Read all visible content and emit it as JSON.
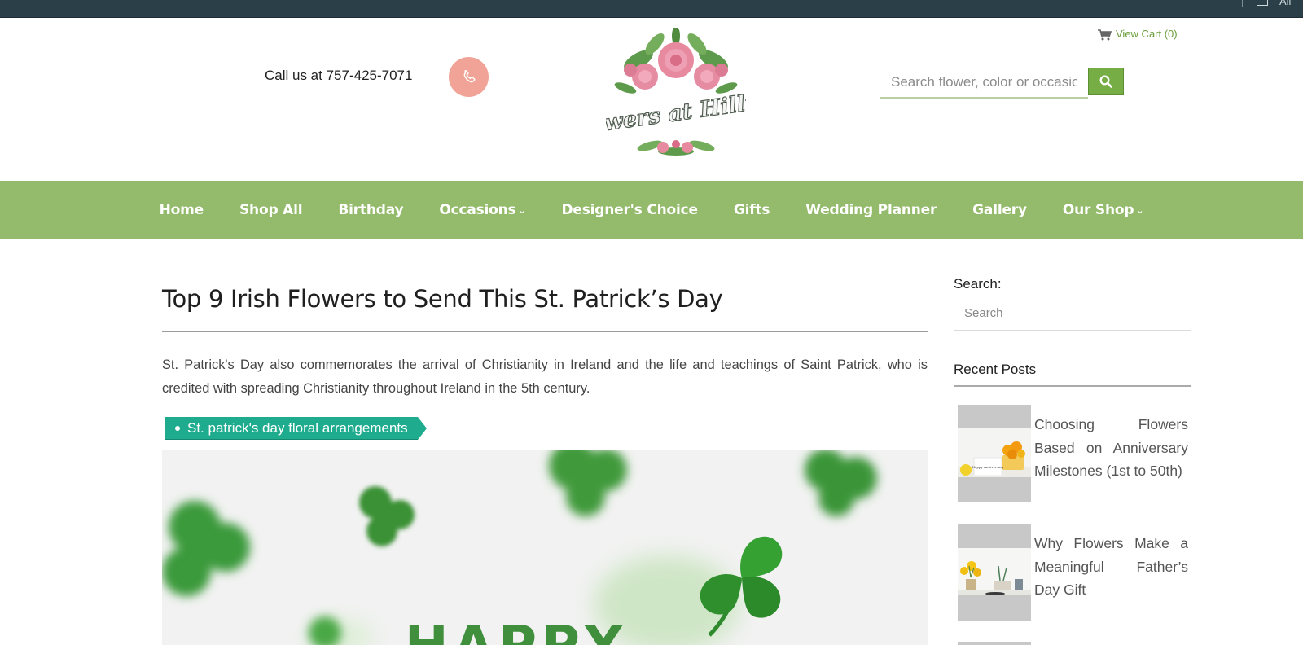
{
  "topbar": {
    "account_text": "All"
  },
  "header": {
    "call_text": "Call us at 757-425-7071",
    "logo_text": "Flowers at Hilltop",
    "cart_label": "View Cart (0)",
    "search_placeholder": "Search flower, color or occasion",
    "icons": {
      "phone": "phone-icon",
      "cart": "cart-icon",
      "search": "search-icon"
    }
  },
  "nav": {
    "items": [
      {
        "label": "Home",
        "dropdown": false
      },
      {
        "label": "Shop All",
        "dropdown": false
      },
      {
        "label": "Birthday",
        "dropdown": false
      },
      {
        "label": "Occasions",
        "dropdown": true
      },
      {
        "label": "Designer's Choice",
        "dropdown": false
      },
      {
        "label": "Gifts",
        "dropdown": false
      },
      {
        "label": "Wedding Planner",
        "dropdown": false
      },
      {
        "label": "Gallery",
        "dropdown": false
      },
      {
        "label": "Our Shop",
        "dropdown": true
      }
    ],
    "chevron": "⌄"
  },
  "post": {
    "title": "Top 9 Irish Flowers to Send This St. Patrick’s Day",
    "intro": "St. Patrick's Day also commemorates the arrival of Christianity in Ireland and the life and teachings of Saint Patrick, who is credited with spreading Christianity throughout Ireland in the 5th century.",
    "tag": "St. patrick's day floral arrangements",
    "hero_text": "HAPPY"
  },
  "sidebar": {
    "search_label": "Search:",
    "search_placeholder": "Search",
    "recent_heading": "Recent Posts",
    "recent_posts": [
      {
        "title": "Choosing Flowers Based on Anniversary Milestones (1st to 50th)",
        "thumb_caption": "Happy Anniversary"
      },
      {
        "title": "Why Flowers Make a Meaningful Father’s Day Gift"
      }
    ]
  },
  "colors": {
    "nav_green": "#94ba6b",
    "button_green": "#77ad45",
    "tag_teal": "#1fac8e",
    "topbar": "#2a3f47",
    "phone_circle": "#f0a396"
  }
}
